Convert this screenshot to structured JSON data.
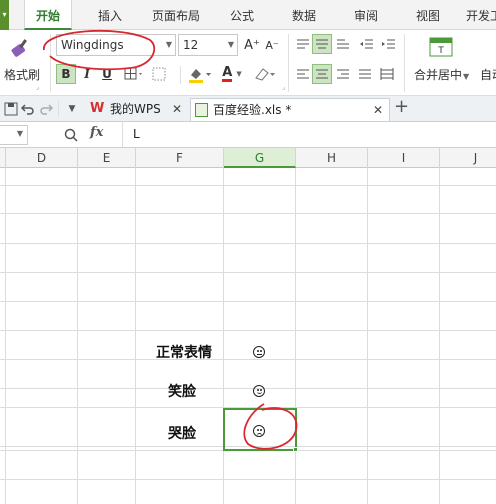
{
  "menu": {
    "tabs": [
      "开始",
      "插入",
      "页面布局",
      "公式",
      "数据",
      "审阅",
      "视图",
      "开发工"
    ],
    "active": 0
  },
  "ribbon": {
    "format_painter": "格式刷",
    "font_name": "Wingdings",
    "font_size": "12",
    "bold": "B",
    "italic": "I",
    "underline": "U",
    "merge_center": "合并居中",
    "auto_wrap": "自动",
    "font_color_letter": "A",
    "inc_font": "A⁺",
    "dec_font": "A⁻",
    "merge_icon_letter": "T"
  },
  "docbar": {
    "tabs": [
      {
        "label": "我的WPS"
      },
      {
        "label": "百度经验.xls *"
      }
    ],
    "new_tab": "+"
  },
  "formula_bar": {
    "fx": "fx",
    "content": "L"
  },
  "columns": [
    "D",
    "E",
    "F",
    "G",
    "H",
    "I",
    "J"
  ],
  "selected_column": "G",
  "cells": {
    "normal_label": "正常表情",
    "smile_label": "笑脸",
    "cry_label": "哭脸"
  },
  "annotation_color": "#d9282f",
  "accent_color": "#4a9a3a"
}
